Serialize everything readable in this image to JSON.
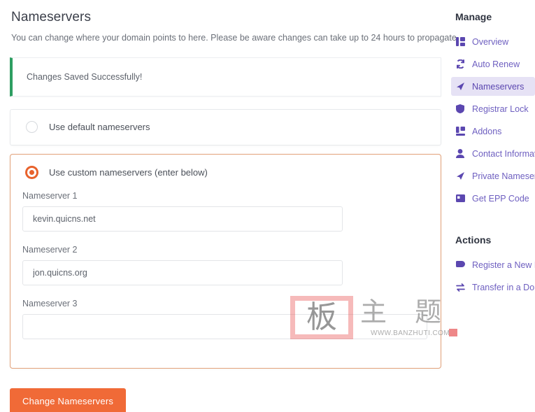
{
  "main": {
    "title": "Nameservers",
    "description": "You can change where your domain points to here. Please be aware changes can take up to 24 hours to propagate.",
    "alert": {
      "message": "Changes Saved Successfully!",
      "accent_color": "#2e9e62"
    },
    "options": {
      "default": {
        "label": "Use default nameservers",
        "selected": false
      },
      "custom": {
        "label": "Use custom nameservers (enter below)",
        "selected": true,
        "accent_color": "#e8622c"
      }
    },
    "nameservers": [
      {
        "label": "Nameserver 1",
        "value": "kevin.quicns.net",
        "placeholder": ""
      },
      {
        "label": "Nameserver 2",
        "value": "jon.quicns.org",
        "placeholder": ""
      },
      {
        "label": "Nameserver 3",
        "value": "",
        "placeholder": ""
      }
    ],
    "submit": {
      "label": "Change Nameservers",
      "color": "#f06a37"
    }
  },
  "sidebar": {
    "manage_heading": "Manage",
    "manage_items": [
      {
        "label": "Overview",
        "icon": "grid-icon",
        "active": false
      },
      {
        "label": "Auto Renew",
        "icon": "refresh-icon",
        "active": false
      },
      {
        "label": "Nameservers",
        "icon": "arrow-icon",
        "active": true
      },
      {
        "label": "Registrar Lock",
        "icon": "shield-icon",
        "active": false
      },
      {
        "label": "Addons",
        "icon": "layers-icon",
        "active": false
      },
      {
        "label": "Contact Informat",
        "icon": "user-icon",
        "active": false
      },
      {
        "label": "Private Nameserv",
        "icon": "arrow-icon",
        "active": false
      },
      {
        "label": "Get EPP Code",
        "icon": "card-icon",
        "active": false
      }
    ],
    "actions_heading": "Actions",
    "actions_items": [
      {
        "label": "Register a New D",
        "icon": "flag-icon"
      },
      {
        "label": "Transfer in a Dom",
        "icon": "transfer-icon"
      }
    ],
    "accent_color": "#5b47b0",
    "active_bg": "#e6e2f5"
  },
  "watermark": {
    "stamp_char": "板",
    "chars": "主 题",
    "url": "WWW.BANZHUTI.COM"
  }
}
